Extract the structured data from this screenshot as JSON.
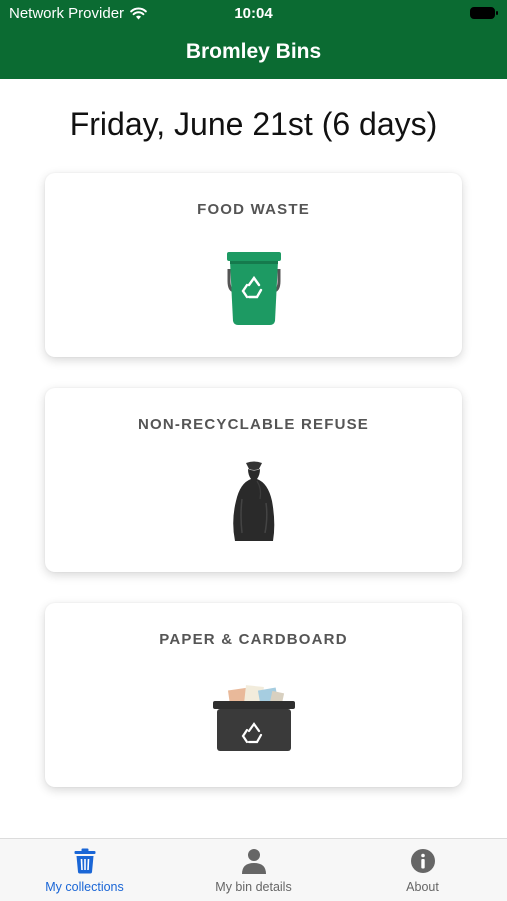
{
  "status_bar": {
    "carrier": "Network Provider",
    "time": "10:04"
  },
  "header": {
    "title": "Bromley Bins"
  },
  "next_collection": "Friday, June 21st (6 days)",
  "collections": [
    {
      "title": "FOOD WASTE",
      "icon": "food-waste-caddy-icon"
    },
    {
      "title": "NON-RECYCLABLE REFUSE",
      "icon": "black-bin-bag-icon"
    },
    {
      "title": "PAPER & CARDBOARD",
      "icon": "recycling-box-icon"
    }
  ],
  "tabs": [
    {
      "label": "My collections",
      "icon": "trash-icon",
      "active": true
    },
    {
      "label": "My bin details",
      "icon": "person-icon",
      "active": false
    },
    {
      "label": "About",
      "icon": "info-icon",
      "active": false
    }
  ],
  "colors": {
    "brand_green": "#0b6b32",
    "tab_active": "#1a66d6",
    "caddy_green": "#1d9a63"
  }
}
